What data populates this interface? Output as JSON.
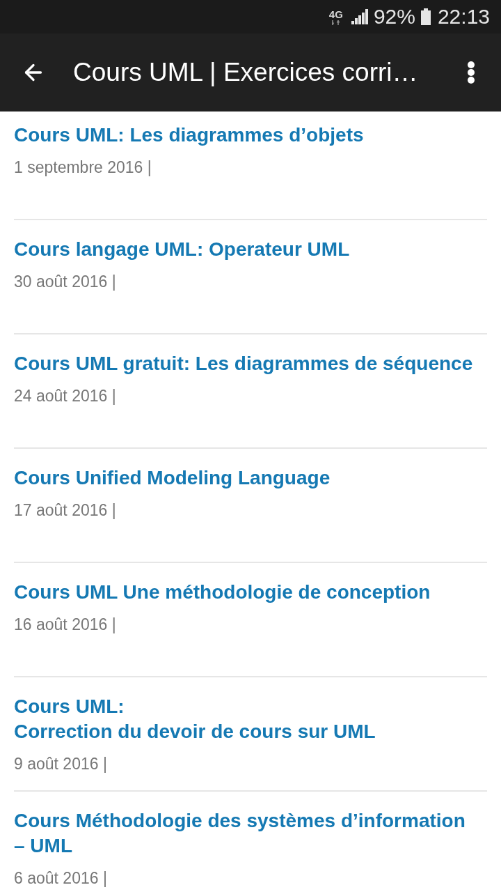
{
  "status_bar": {
    "network": "4G",
    "battery": "92%",
    "time": "22:13"
  },
  "app_bar": {
    "title": "Cours UML | Exercices corri…"
  },
  "posts": [
    {
      "title": "Cours UML: Les diagrammes d’objets",
      "date": "1 septembre 2016 |"
    },
    {
      "title": "Cours langage UML: Operateur UML",
      "date": "30 août 2016 |"
    },
    {
      "title": "Cours UML gratuit: Les diagrammes de séquence",
      "date": "24 août 2016 |"
    },
    {
      "title": "Cours Unified Modeling Language",
      "date": "17 août 2016 |"
    },
    {
      "title": "Cours UML Une méthodologie de conception",
      "date": "16 août 2016 |"
    },
    {
      "title": "Cours UML:\nCorrection du devoir de cours sur UML",
      "date": "9 août 2016 |"
    },
    {
      "title": "Cours Méthodologie des systèmes d’information – UML",
      "date": "6 août 2016 |"
    }
  ]
}
